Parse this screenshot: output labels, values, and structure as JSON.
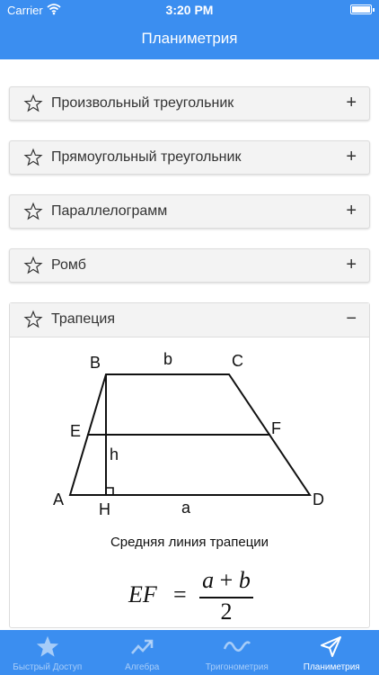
{
  "status_bar": {
    "carrier": "Carrier",
    "time": "3:20 PM"
  },
  "nav": {
    "title": "Планиметрия"
  },
  "items": [
    {
      "label": "Произвольный треугольник",
      "toggle": "+"
    },
    {
      "label": "Прямоугольный треугольник",
      "toggle": "+"
    },
    {
      "label": "Параллелограмм",
      "toggle": "+"
    },
    {
      "label": "Ромб",
      "toggle": "+"
    }
  ],
  "expanded": {
    "label": "Трапеция",
    "toggle": "−",
    "diagram_labels": {
      "A": "A",
      "B": "B",
      "C": "C",
      "D": "D",
      "E": "E",
      "F": "F",
      "H": "H",
      "a": "a",
      "b": "b",
      "h": "h"
    },
    "caption": "Средняя линия трапеции",
    "formula": {
      "left": "EF",
      "eq": "=",
      "num_a": "a",
      "plus": " + ",
      "num_b": "b",
      "den": "2"
    }
  },
  "tabs": [
    {
      "label": "Быстрый Доступ",
      "icon": "star-icon",
      "active": false
    },
    {
      "label": "Алгебра",
      "icon": "trend-icon",
      "active": false
    },
    {
      "label": "Тригонометрия",
      "icon": "sine-icon",
      "active": false
    },
    {
      "label": "Планиметрия",
      "icon": "paper-plane-icon",
      "active": true
    }
  ],
  "colors": {
    "accent": "#3b8ef0",
    "item_bg": "#f3f3f3"
  }
}
